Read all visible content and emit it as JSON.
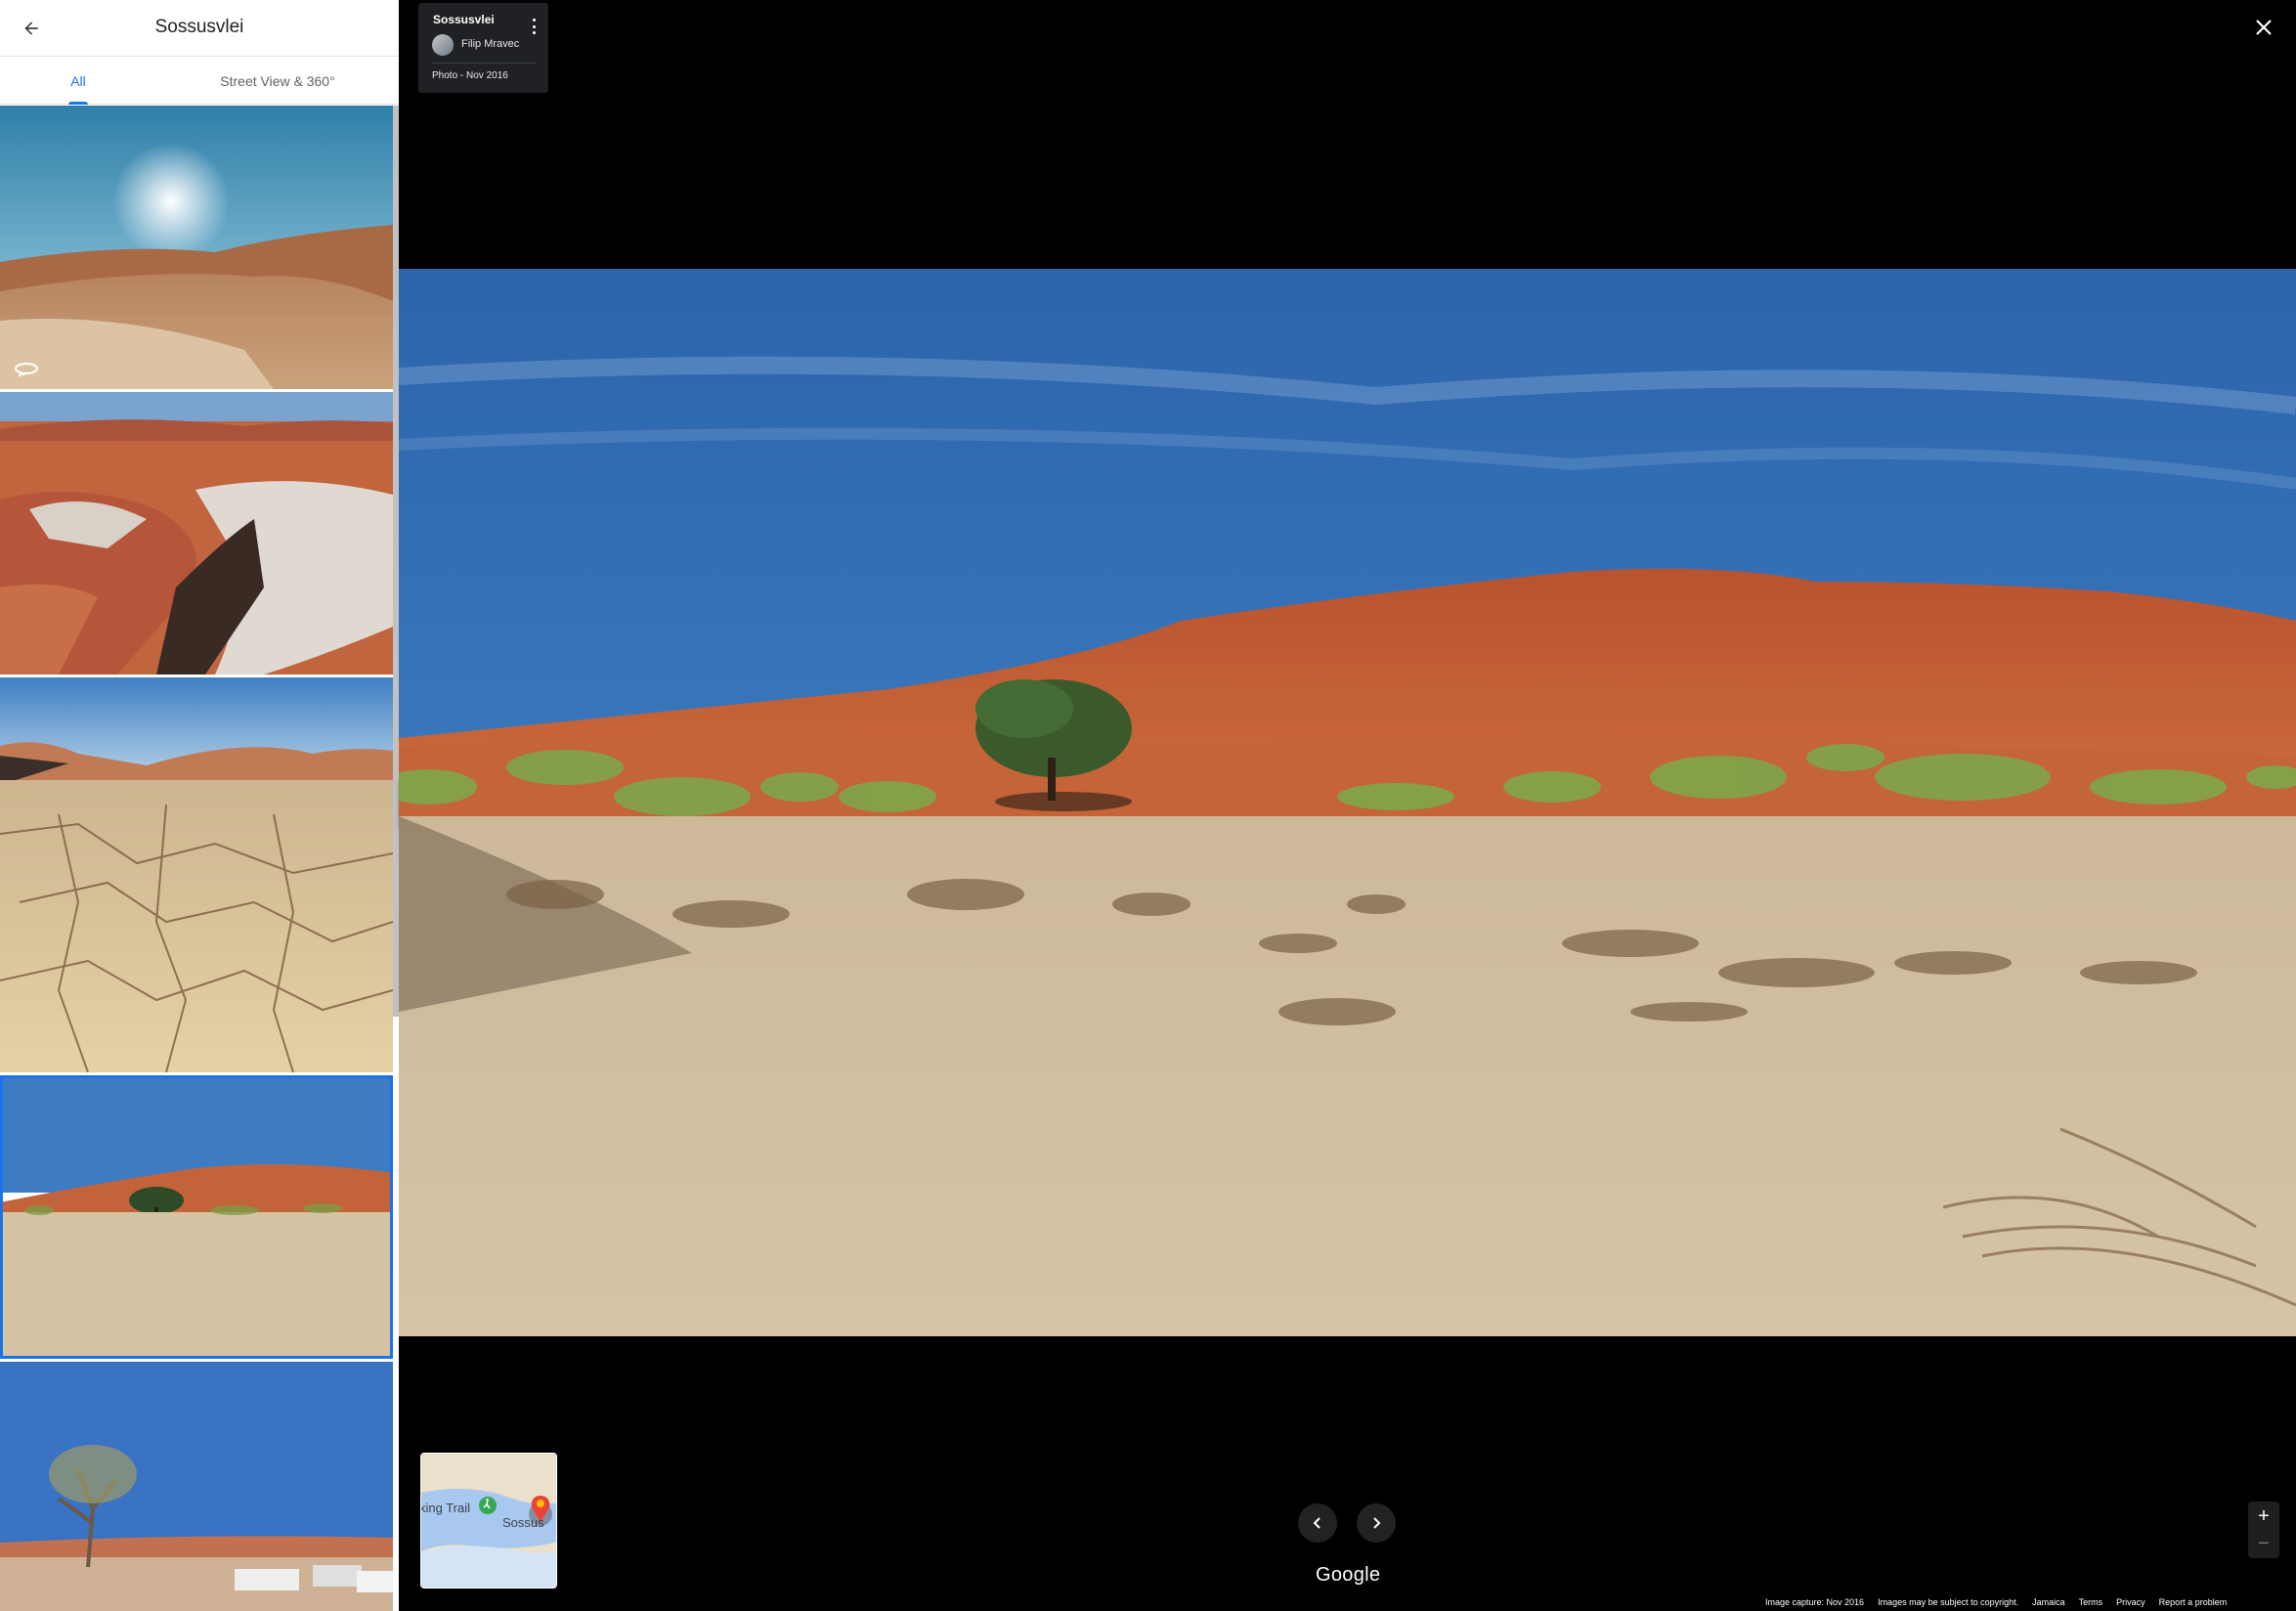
{
  "sidebar": {
    "title": "Sossusvlei",
    "tabs": [
      {
        "label": "All"
      },
      {
        "label": "Street View & 360°"
      }
    ]
  },
  "info_card": {
    "title": "Sossusvlei",
    "author": "Filip Mravec",
    "date": "Photo - Nov 2016"
  },
  "minimap": {
    "label_left": "king Trail",
    "label_right": "Sossus"
  },
  "logo": "Google",
  "zoom": {
    "in": "+",
    "out": "−"
  },
  "footer": {
    "capture": "Image capture: Nov 2016",
    "copyright": "Images may be subject to copyright.",
    "region": "Jamaica",
    "terms": "Terms",
    "privacy": "Privacy",
    "report": "Report a problem"
  },
  "colors": {
    "accent": "#1a73e8",
    "sky": "#3f7fc6",
    "dune": "#c9633c",
    "sand": "#d8c6a9"
  }
}
